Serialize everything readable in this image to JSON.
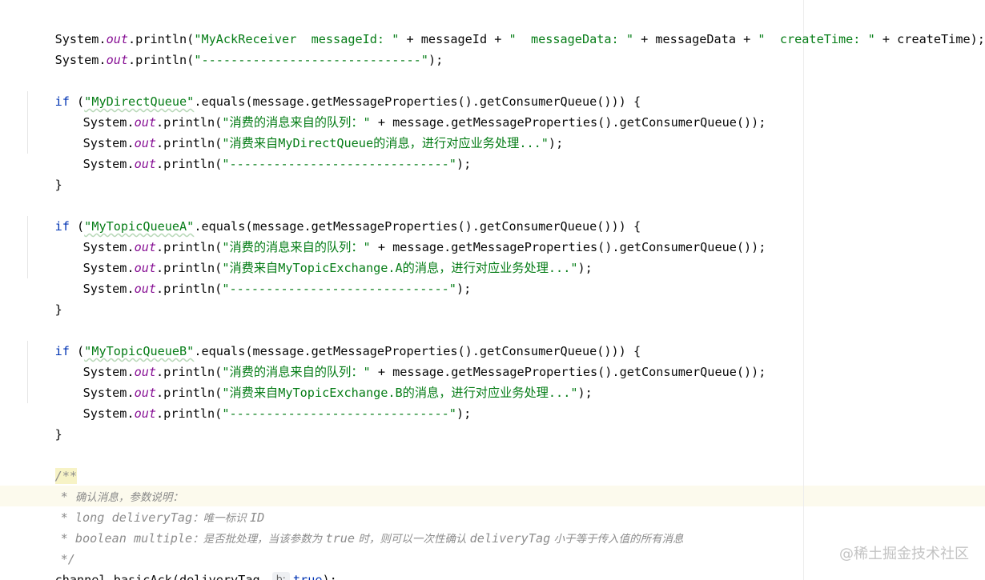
{
  "editor": {
    "lines": {
      "print_ack": {
        "a": "System.",
        "b": "out",
        "c": ".println(",
        "d": "\"MyAckReceiver  messageId: \"",
        "e": " + messageId + ",
        "f": "\"  messageData: \"",
        "g": " + messageData + ",
        "h": "\"  createTime: \"",
        "i": " + createTime);"
      },
      "print_sep_top": {
        "a": "System.",
        "b": "out",
        "c": ".println(",
        "d": "\"------------------------------\"",
        "e": ");"
      },
      "blocks": [
        {
          "if_kw": "if",
          "paren_open": " (",
          "queue_name": "\"MyDirectQueue\"",
          "cond_rest": ".equals(message.getMessageProperties().getConsumerQueue())) {",
          "l1": {
            "a": "System.",
            "b": "out",
            "c": ".println(",
            "d": "\"消费的消息来自的队列：\"",
            "e": " + message.getMessageProperties().getConsumerQueue());"
          },
          "l2": {
            "a": "System.",
            "b": "out",
            "c": ".println(",
            "d": "\"消费来自MyDirectQueue的消息，进行对应业务处理...\"",
            "e": ");"
          },
          "l3": {
            "a": "System.",
            "b": "out",
            "c": ".println(",
            "d": "\"------------------------------\"",
            "e": ");"
          },
          "close": "}"
        },
        {
          "if_kw": "if",
          "paren_open": " (",
          "queue_name": "\"MyTopicQueueA\"",
          "cond_rest": ".equals(message.getMessageProperties().getConsumerQueue())) {",
          "l1": {
            "a": "System.",
            "b": "out",
            "c": ".println(",
            "d": "\"消费的消息来自的队列：\"",
            "e": " + message.getMessageProperties().getConsumerQueue());"
          },
          "l2": {
            "a": "System.",
            "b": "out",
            "c": ".println(",
            "d": "\"消费来自MyTopicExchange.A的消息，进行对应业务处理...\"",
            "e": ");"
          },
          "l3": {
            "a": "System.",
            "b": "out",
            "c": ".println(",
            "d": "\"------------------------------\"",
            "e": ");"
          },
          "close": "}"
        },
        {
          "if_kw": "if",
          "paren_open": " (",
          "queue_name": "\"MyTopicQueueB\"",
          "cond_rest": ".equals(message.getMessageProperties().getConsumerQueue())) {",
          "l1": {
            "a": "System.",
            "b": "out",
            "c": ".println(",
            "d": "\"消费的消息来自的队列：\"",
            "e": " + message.getMessageProperties().getConsumerQueue());"
          },
          "l2": {
            "a": "System.",
            "b": "out",
            "c": ".println(",
            "d": "\"消费来自MyTopicExchange.B的消息，进行对应业务处理...\"",
            "e": ");"
          },
          "l3": {
            "a": "System.",
            "b": "out",
            "c": ".println(",
            "d": "\"------------------------------\"",
            "e": ");"
          },
          "close": "}"
        }
      ],
      "doc": {
        "start": "/**",
        "l1_star": "* ",
        "l1_text": "确认消息，参数说明：",
        "l2_star": "* ",
        "l2_param": "long deliveryTag",
        "l2_text": "：唯一标识 ",
        "l2_id": "ID",
        "l3_star": "* ",
        "l3_param": "boolean multiple",
        "l3_text1": "：是否批处理，当该参数为 ",
        "l3_true": "true",
        "l3_text2": " 时，则可以一次性确认 ",
        "l3_tag": "deliveryTag",
        "l3_text3": " 小于等于传入值的所有消息",
        "end": "*/"
      },
      "ack_call": {
        "a": "channel.basicAck(deliveryTag,",
        "hint": "b:",
        "b": "true",
        "c": ");"
      }
    },
    "watermark": "@稀土掘金技术社区"
  }
}
